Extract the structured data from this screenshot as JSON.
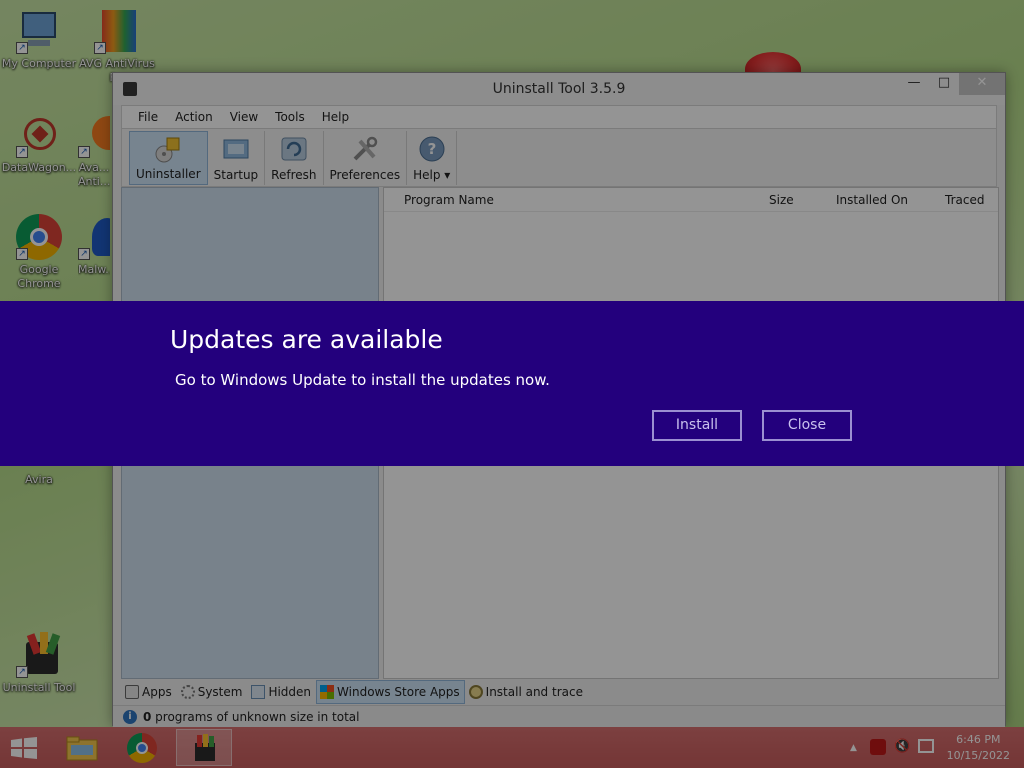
{
  "desktop": {
    "icons": [
      {
        "label": "My Computer"
      },
      {
        "label": "AVG AntiVirus F..."
      },
      {
        "label": "DataWagon..."
      },
      {
        "label": "Ava... Anti..."
      },
      {
        "label": "Google Chrome"
      },
      {
        "label": "Malw..."
      },
      {
        "label": "Avira"
      },
      {
        "label": "Uninstall Tool"
      }
    ]
  },
  "window": {
    "title": "Uninstall Tool 3.5.9",
    "controls": {
      "minimize": "—",
      "maximize": "□",
      "close": "✕"
    },
    "menu": [
      "File",
      "Action",
      "View",
      "Tools",
      "Help"
    ],
    "toolbar": [
      {
        "label": "Uninstaller",
        "icon": "uninstaller-icon"
      },
      {
        "label": "Startup",
        "icon": "startup-icon"
      },
      {
        "label": "Refresh",
        "icon": "refresh-icon"
      },
      {
        "label": "Preferences",
        "icon": "preferences-icon"
      },
      {
        "label": "Help ▾",
        "icon": "help-icon"
      }
    ],
    "columns": [
      "Program Name",
      "Size",
      "Installed On",
      "Traced"
    ],
    "bottom_tabs": [
      {
        "label": "Apps"
      },
      {
        "label": "System"
      },
      {
        "label": "Hidden"
      },
      {
        "label": "Windows Store Apps"
      },
      {
        "label": "Install and trace"
      }
    ],
    "status": {
      "count": "0",
      "text": " programs of unknown size in total"
    }
  },
  "banner": {
    "title": "Updates are available",
    "message": "Go to Windows Update to install the updates now.",
    "install_label": "Install",
    "close_label": "Close",
    "color": "#23007d"
  },
  "taskbar": {
    "time": "6:46 PM",
    "date": "10/15/2022"
  }
}
